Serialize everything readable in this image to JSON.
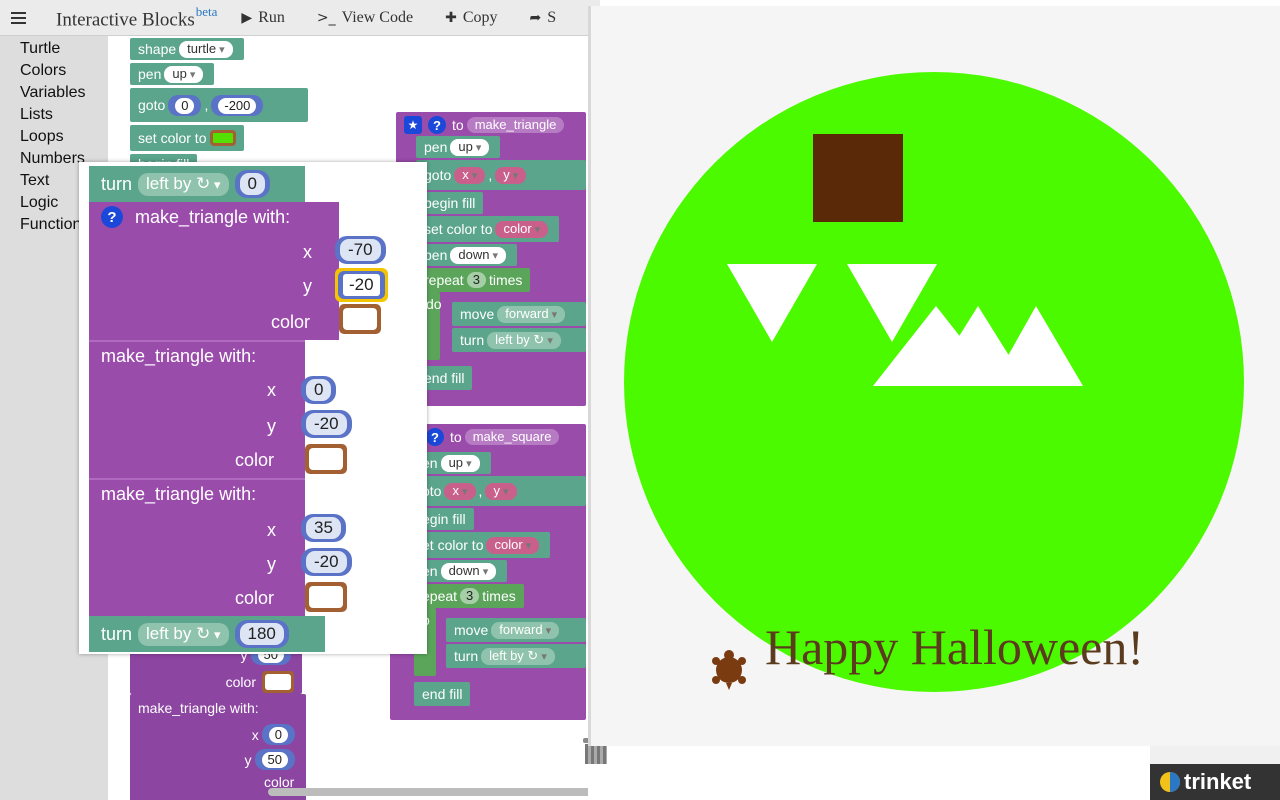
{
  "app": {
    "title": "Interactive Blocks",
    "badge": "beta"
  },
  "toolbar": {
    "menu_icon": "menu-icon",
    "run": "Run",
    "view_code": "View Code",
    "copy": "Copy",
    "share": "S"
  },
  "toolbox": {
    "categories": [
      "Turtle",
      "Colors",
      "Variables",
      "Lists",
      "Loops",
      "Numbers",
      "Text",
      "Logic",
      "Functions"
    ]
  },
  "workspace": {
    "left_stack": {
      "shape_label": "shape",
      "shape_value": "turtle",
      "pen_label": "pen",
      "pen_value": "up",
      "goto_label": "goto",
      "goto_x": "0",
      "goto_sep": ",",
      "goto_y": "-200",
      "set_color_label": "set color to",
      "begin_fill_label": "begin fill",
      "y_label": "y",
      "y_value": "50",
      "color_label": "color",
      "make_triangle_label": "make_triangle  with:",
      "x_label": "x",
      "x2_value": "0",
      "y2_value": "50",
      "color2_label": "color"
    },
    "make_triangle_def": {
      "to_label": "to",
      "name": "make_triangle",
      "pen_label": "pen",
      "pen_value": "up",
      "goto_label": "goto",
      "x_var": "x",
      "sep": ",",
      "y_var": "y",
      "begin_fill_label": "begin fill",
      "set_color_label": "set color to",
      "color_var": "color",
      "pen2_label": "pen",
      "pen2_value": "down",
      "repeat_label": "repeat",
      "repeat_count": "3",
      "times_label": "times",
      "do_label": "do",
      "move_label": "move",
      "move_value": "forward",
      "turn_label": "turn",
      "turn_value": "left by ↻",
      "end_fill_label": "end fill"
    },
    "make_square_def": {
      "to_label": "to",
      "name": "make_square",
      "pen_label": "en",
      "pen_value": "up",
      "goto_label": "oto",
      "x_var": "x",
      "sep": ",",
      "y_var": "y",
      "begin_fill_label": "egin fill",
      "set_color_label": "et color to",
      "color_var": "color",
      "pen2_label": "en",
      "pen2_value": "down",
      "repeat_label": "epeat",
      "repeat_count": "3",
      "times_label": "times",
      "do_label": "o",
      "move_label": "move",
      "move_value": "forward",
      "turn_label": "turn",
      "turn_value": "left by ↻",
      "end_fill_label": "end fill"
    }
  },
  "zoom_overlay": {
    "turn1": {
      "label": "turn",
      "dir": "left by ↻",
      "value": "0"
    },
    "call1": {
      "label": "make_triangle  with:",
      "x_label": "x",
      "x_value": "-70",
      "y_label": "y",
      "y_value": "-20",
      "color_label": "color"
    },
    "call2": {
      "label": "make_triangle  with:",
      "x_label": "x",
      "x_value": "0",
      "y_label": "y",
      "y_value": "-20",
      "color_label": "color"
    },
    "call3": {
      "label": "make_triangle  with:",
      "x_label": "x",
      "x_value": "35",
      "y_label": "y",
      "y_value": "-20",
      "color_label": "color"
    },
    "turn2": {
      "label": "turn",
      "dir": "left by ↻",
      "value": "180"
    }
  },
  "canvas": {
    "message": "Happy Halloween!",
    "colors": {
      "background": "#f5f5f5",
      "pumpkin": "#4cfa00",
      "stem": "#5a2a08",
      "eyes_teeth": "#ffffff",
      "text": "#5a3b1e",
      "turtle": "#7a3b10"
    }
  },
  "brand": {
    "name": "trinket"
  },
  "colors": {
    "turtle_block": "#5ba58c",
    "function_block": "#9a4cab",
    "number_field": "#5b73c7",
    "color_field": "#a36133",
    "highlight": "#f5c400"
  }
}
